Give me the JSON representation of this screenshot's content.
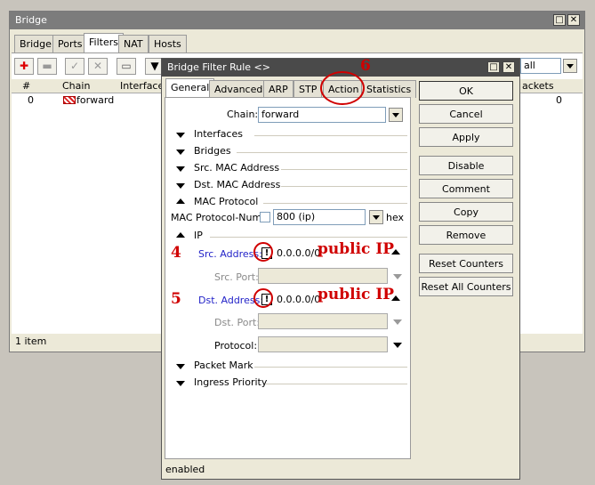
{
  "main_window": {
    "title": "Bridge",
    "tabs": [
      "Bridge",
      "Ports",
      "Filters",
      "NAT",
      "Hosts"
    ],
    "active_tab": "Filters",
    "filter_combo": "all",
    "columns": [
      "#",
      "Chain",
      "Interfaces",
      "ackets"
    ],
    "row": {
      "num": "0",
      "chain": "forward",
      "packets": "0"
    },
    "status": "1 item"
  },
  "dialog": {
    "title": "Bridge Filter Rule <>",
    "tabs": [
      "General",
      "Advanced",
      "ARP",
      "STP",
      "Action",
      "Statistics"
    ],
    "chain_label": "Chain:",
    "chain_value": "forward",
    "sections": {
      "interfaces": "Interfaces",
      "bridges": "Bridges",
      "src_mac": "Src. MAC Address",
      "dst_mac": "Dst. MAC Address",
      "mac_protocol": "MAC Protocol",
      "ip": "IP",
      "packet_mark": "Packet Mark",
      "ingress_priority": "Ingress Priority"
    },
    "mac_protocol_num_label": "MAC Protocol-Num:",
    "mac_protocol_num_value": "800 (ip)",
    "hex_label": "hex",
    "src_address_label": "Src. Address:",
    "src_address_value": "0.0.0.0/0",
    "src_port_label": "Src. Port:",
    "dst_address_label": "Dst. Address:",
    "dst_address_value": "0.0.0.0/0",
    "dst_port_label": "Dst. Port:",
    "protocol_label": "Protocol:",
    "not_symbol": "!",
    "buttons": [
      "OK",
      "Cancel",
      "Apply",
      "Disable",
      "Comment",
      "Copy",
      "Remove",
      "Reset Counters",
      "Reset All Counters"
    ],
    "status": "enabled"
  },
  "annotations": {
    "num4": "4",
    "num5": "5",
    "num6": "6",
    "public_ip_1": "public IP",
    "public_ip_2": "public IP"
  },
  "colors": {
    "annotation": "#d00000",
    "titlebar": "#7c7c7c",
    "label_blue": "#2323c8"
  }
}
